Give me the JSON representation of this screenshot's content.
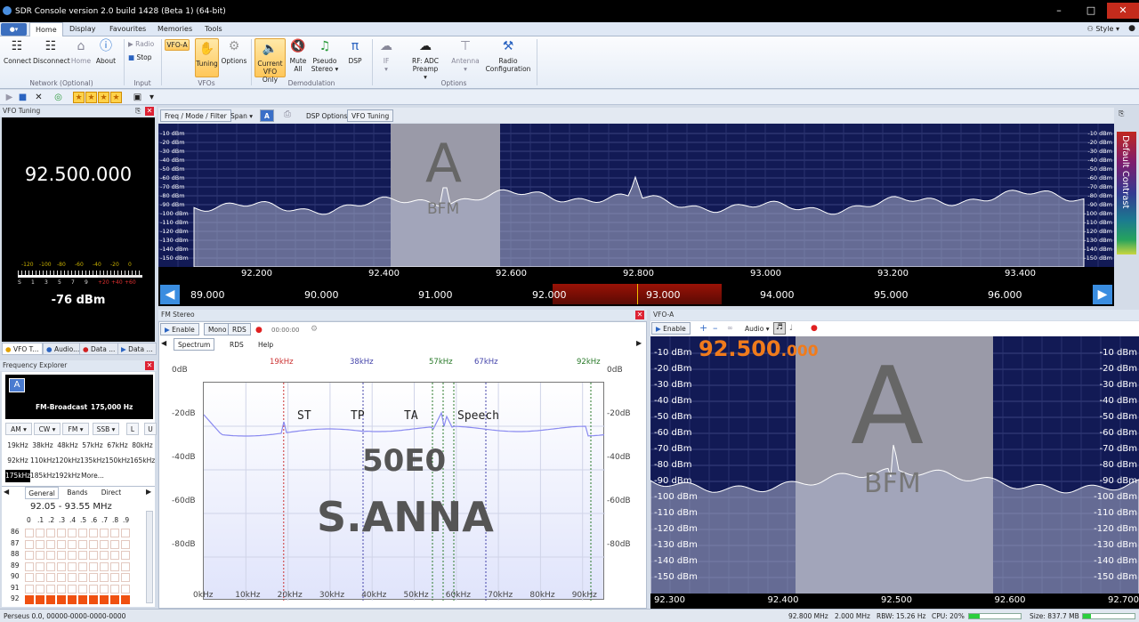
{
  "window": {
    "title": "SDR Console version 2.0 build 1428 (Beta 1) (64-bit)"
  },
  "tabs": [
    "Home",
    "Display",
    "Favourites",
    "Memories",
    "Tools"
  ],
  "style_label": "Style",
  "ribbon": {
    "network": {
      "connect": "Connect",
      "disconnect": "Disconnect",
      "home": "Home",
      "about": "About",
      "group": "Network (Optional)"
    },
    "input": {
      "radio": "Radio",
      "stop": "Stop",
      "group": "Input"
    },
    "vfos": {
      "vfo_a": "VFO-A",
      "tuning": "Tuning",
      "options": "Options",
      "group": "VFOs"
    },
    "demod": {
      "current": "Current",
      "current2": "VFO Only",
      "mute": "Mute",
      "mute2": "All",
      "pseudo": "Pseudo",
      "pseudo2": "Stereo ▾",
      "dsp": "DSP",
      "group": "Demodulation"
    },
    "options": {
      "if": "IF",
      "rf": "RF: ADC Preamp",
      "antenna": "Antenna",
      "radio_cfg": "Radio",
      "radio_cfg2": "Configuration",
      "group": "Options"
    }
  },
  "vfo_tuning": {
    "title": "VFO Tuning",
    "frequency": "92.500.000",
    "dbm": "-76 dBm",
    "meter_top": [
      "-120",
      "-100",
      "-80",
      "-60",
      "-40",
      "-20",
      "0"
    ],
    "meter_bottom": [
      "S",
      "1",
      "3",
      "5",
      "7",
      "9",
      "+20",
      "+40",
      "+60"
    ]
  },
  "left_tabs": [
    "VFO T...",
    "Audio...",
    "Data ...",
    "Data ..."
  ],
  "freq_explorer": {
    "title": "Frequency Explorer",
    "mode_name": "FM-Broadcast",
    "bandwidth": "175,000 Hz",
    "modes": [
      "AM ▾",
      "CW ▾",
      "FM ▾",
      "SSB ▾",
      "L",
      "U"
    ],
    "bandwidths": [
      "19kHz",
      "38kHz",
      "48kHz",
      "57kHz",
      "67kHz",
      "80kHz",
      "92kHz",
      "110kHz",
      "120kHz",
      "135kHz",
      "150kHz",
      "165kHz",
      "175kHz",
      "185kHz",
      "192kHz",
      "More..."
    ],
    "tabs": [
      "General",
      "Bands",
      "Direct"
    ],
    "range": "92.05 - 93.55 MHz",
    "columns": [
      "0",
      ".1",
      ".2",
      ".3",
      ".4",
      ".5",
      ".6",
      ".7",
      ".8",
      ".9"
    ],
    "rows": [
      "86",
      "87",
      "88",
      "89",
      "90",
      "91",
      "92"
    ]
  },
  "spectrum": {
    "toolbar": [
      "Freq / Mode / Filter",
      "Span ▾",
      "A",
      "DSP Options",
      "VFO Tuning"
    ],
    "db_labels": [
      "-10 dBm",
      "-20 dBm",
      "-30 dBm",
      "-40 dBm",
      "-50 dBm",
      "-60 dBm",
      "-70 dBm",
      "-80 dBm",
      "-90 dBm",
      "-100 dBm",
      "-110 dBm",
      "-120 dBm",
      "-130 dBm",
      "-140 dBm",
      "-150 dBm"
    ],
    "freq_labels": [
      "92.200",
      "92.400",
      "92.600",
      "92.800",
      "93.000",
      "93.200",
      "93.400"
    ],
    "band_labels": [
      "89.000",
      "90.000",
      "91.000",
      "92.000",
      "93.000",
      "94.000",
      "95.000",
      "96.000"
    ],
    "vfo_letter": "A",
    "mode": "BFM",
    "contrast_label": "Default Contrast"
  },
  "fm_stereo": {
    "title": "FM Stereo",
    "enable": "Enable",
    "mono": "Mono",
    "rds": "RDS",
    "time": "00:00:00",
    "tabs": [
      "Spectrum",
      "RDS",
      "Help"
    ],
    "markers": [
      "19kHz",
      "38kHz",
      "57kHz",
      "67kHz",
      "92kHz"
    ],
    "flags": [
      "ST",
      "TP",
      "TA",
      "Speech"
    ],
    "pi_code": "50E0",
    "ps_name": "S.ANNA",
    "y_labels": [
      "0dB",
      "-20dB",
      "-40dB",
      "-60dB",
      "-80dB"
    ],
    "x_labels": [
      "0kHz",
      "10kHz",
      "20kHz",
      "30kHz",
      "40kHz",
      "50kHz",
      "60kHz",
      "70kHz",
      "80kHz",
      "90kHz"
    ]
  },
  "vfo_a": {
    "title": "VFO-A",
    "enable": "Enable",
    "audio": "Audio ▾",
    "frequency_main": "92.500",
    "frequency_sub": ".000",
    "db_labels": [
      "-10 dBm",
      "-20 dBm",
      "-30 dBm",
      "-40 dBm",
      "-50 dBm",
      "-60 dBm",
      "-70 dBm",
      "-80 dBm",
      "-90 dBm",
      "-100 dBm",
      "-110 dBm",
      "-120 dBm",
      "-130 dBm",
      "-140 dBm",
      "-150 dBm"
    ],
    "freq_labels": [
      "92.300",
      "92.400",
      "92.500",
      "92.600",
      "92.700"
    ],
    "vfo_letter": "A",
    "mode": "BFM"
  },
  "status": {
    "device": "Perseus 0.0, 00000-0000-0000-0000",
    "center": "92.800 MHz",
    "span": "2.000 MHz",
    "rbw": "RBW: 15.26 Hz",
    "cpu": "CPU: 20%",
    "size": "Size: 837.7 MB",
    "cpu_fraction": 0.2,
    "size_fraction": 0.15
  },
  "colors": {
    "spectrum_bg": "#121a55",
    "passband": "#9a9aa8",
    "accent_orange": "#f07b1c"
  }
}
